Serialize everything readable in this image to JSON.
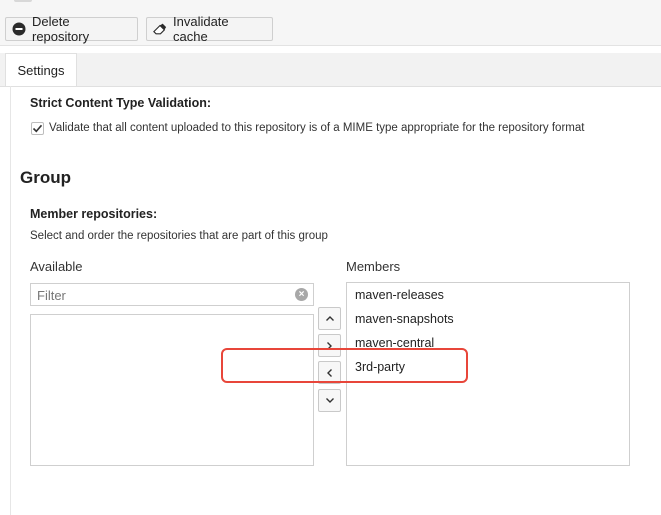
{
  "toolbar": {
    "delete_label": "Delete repository",
    "delete_icon": "minus-circle-icon",
    "invalidate_label": "Invalidate cache",
    "invalidate_icon": "eraser-icon"
  },
  "tabs": [
    {
      "label": "Settings",
      "active": true
    }
  ],
  "strict_validation": {
    "title": "Strict Content Type Validation:",
    "checkbox_label": "Validate that all content uploaded to this repository is of a MIME type appropriate for the repository format",
    "checked": true
  },
  "group": {
    "heading": "Group",
    "member_title": "Member repositories:",
    "member_help": "Select and order the repositories that are part of this group",
    "available_label": "Available",
    "members_label": "Members",
    "filter_placeholder": "Filter",
    "available_items": [],
    "members": [
      "maven-releases",
      "maven-snapshots",
      "maven-central",
      "3rd-party"
    ],
    "highlighted_member": "3rd-party"
  },
  "colors": {
    "highlight": "#e8463a",
    "toolbar_bg": "#f6f6f6",
    "border": "#cfcfcf"
  }
}
